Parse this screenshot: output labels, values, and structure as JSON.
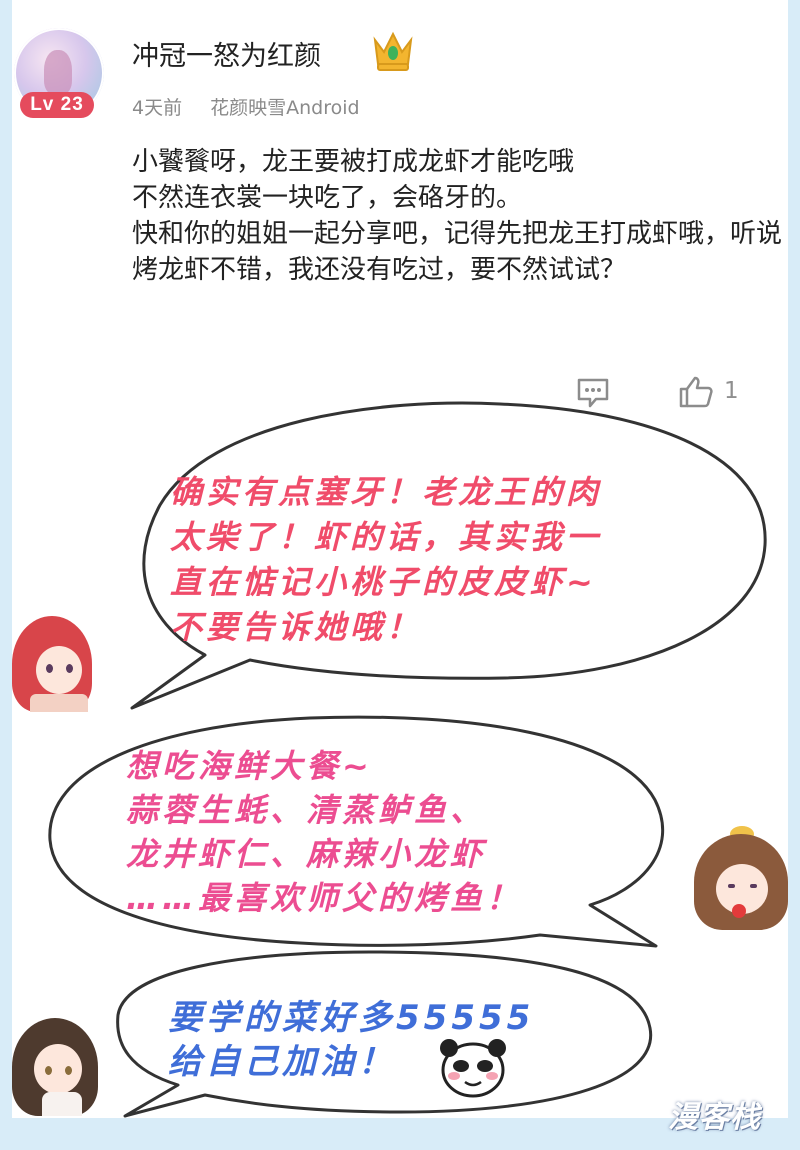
{
  "comment": {
    "username": "冲冠一怒为红颜",
    "level_badge": "Lv 23",
    "time": "4天前",
    "client": "花颜映雪Android",
    "text": "小饕餮呀，龙王要被打成龙虾才能吃哦\n不然连衣裳一块吃了，会硌牙的。\n快和你的姐姐一起分享吧，记得先把龙王打成虾哦，听说烤龙虾不错，我还没有吃过，要不然试试？",
    "like_count": "1",
    "icons": {
      "crown": "crown-icon",
      "reply": "comment-bubble-icon",
      "like": "thumbs-up-icon"
    }
  },
  "replies": [
    {
      "text": "确实有点塞牙！老龙王的肉\n太柴了！虾的话，其实我一\n直在惦记小桃子的皮皮虾~\n不要告诉她哦！",
      "color": "#f04c6a"
    },
    {
      "text": "想吃海鲜大餐~\n蒜蓉生蚝、清蒸鲈鱼、\n龙井虾仁、麻辣小龙虾\n……最喜欢师父的烤鱼！",
      "color": "#ec4d91"
    },
    {
      "text": "要学的菜好多55555\n给自己加油！",
      "color": "#3f6ed8"
    }
  ],
  "watermark": "漫客栈",
  "colors": {
    "level_badge": "#e54b5d",
    "page_background": "#d8ecf8",
    "bubble_outline": "#333333"
  }
}
